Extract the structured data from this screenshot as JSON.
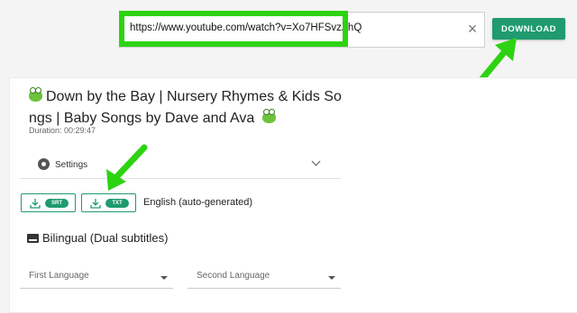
{
  "search": {
    "url_value": "https://www.youtube.com/watch?v=Xo7HFSvzZhQ",
    "download_label": "DOWNLOAD"
  },
  "video": {
    "title": "Down by the Bay | Nursery Rhymes & Kids Songs | Baby Songs by Dave and Ava",
    "duration": "Duration: 00:29:47"
  },
  "settings": {
    "label": "Settings"
  },
  "formats": [
    {
      "label": "SRT"
    },
    {
      "label": "TXT"
    }
  ],
  "language_label": "English (auto-generated)",
  "bilingual": {
    "title": "Bilingual (Dual subtitles)",
    "first_placeholder": "First Language",
    "second_placeholder": "Second Language"
  },
  "colors": {
    "accent": "#1f9b6f",
    "highlight": "#2dd311"
  },
  "icons": [
    "frog-icon",
    "close-icon",
    "gear-icon",
    "chevron-down-icon",
    "download-icon",
    "subtitles-icon",
    "caret-down-icon"
  ]
}
